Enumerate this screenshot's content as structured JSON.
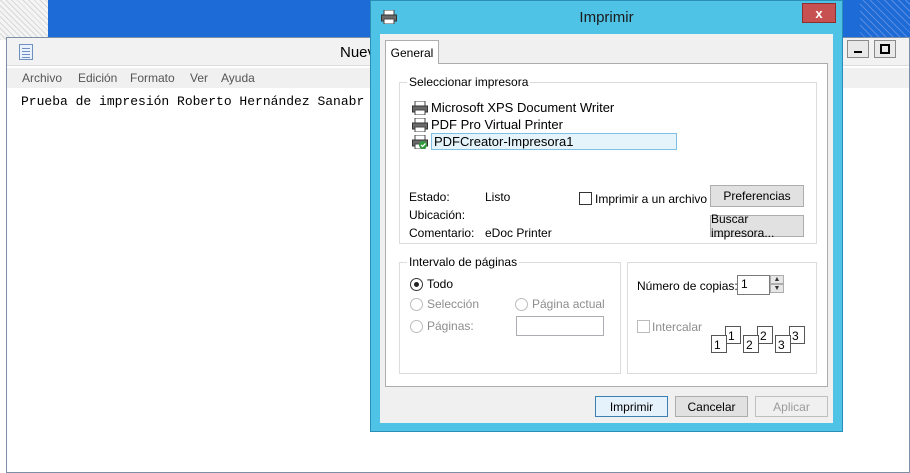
{
  "notepad": {
    "title": "Nuev",
    "menu": [
      "Archivo",
      "Edición",
      "Formato",
      "Ver",
      "Ayuda"
    ],
    "content": "Prueba de impresión Roberto Hernández Sanabr"
  },
  "dialog": {
    "title": "Imprimir",
    "close_label": "x",
    "tab": "General",
    "select_printer": {
      "label": "Seleccionar impresora",
      "printers": [
        {
          "name": "Microsoft XPS Document Writer",
          "icon": "printer-icon"
        },
        {
          "name": "PDF Pro Virtual Printer",
          "icon": "printer-icon"
        },
        {
          "name": "PDFCreator-Impresora1",
          "icon": "default-printer-icon",
          "selected": true
        }
      ],
      "status_label": "Estado:",
      "status_value": "Listo",
      "location_label": "Ubicación:",
      "location_value": "",
      "comment_label": "Comentario:",
      "comment_value": "eDoc Printer",
      "print_to_file": "Imprimir a un archivo",
      "preferences_button": "Preferencias",
      "find_printer_button": "Buscar impresora..."
    },
    "page_range": {
      "label": "Intervalo de páginas",
      "all": "Todo",
      "selection": "Selección",
      "current_page": "Página actual",
      "pages": "Páginas:"
    },
    "copies": {
      "label": "Número de copias:",
      "value": "1",
      "collate": "Intercalar"
    },
    "buttons": {
      "print": "Imprimir",
      "cancel": "Cancelar",
      "apply": "Aplicar"
    }
  },
  "colors": {
    "dialog_frame": "#4fc3e6",
    "close_button": "#c75050",
    "desktop_blue": "#1d6bd6"
  }
}
